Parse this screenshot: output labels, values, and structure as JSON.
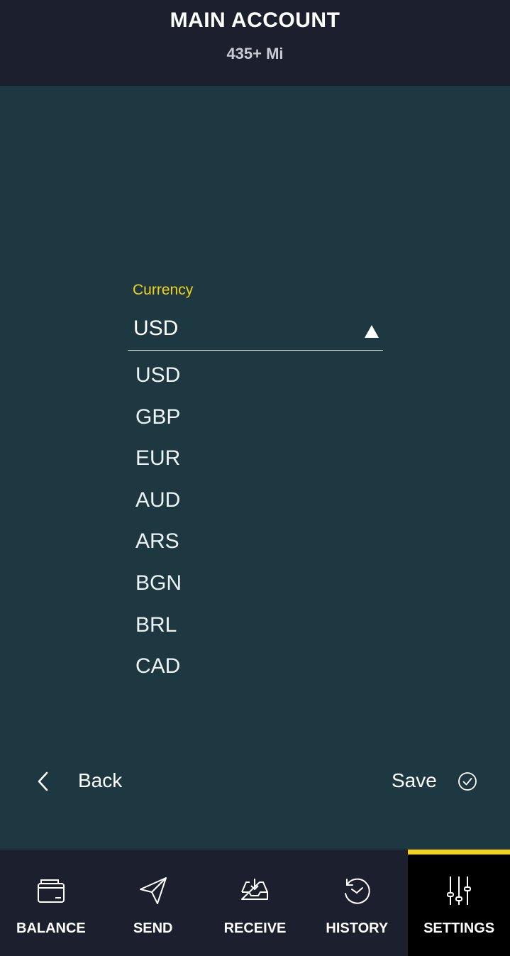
{
  "header": {
    "title": "MAIN ACCOUNT",
    "subtitle": "435+ Mi"
  },
  "form": {
    "currency_label": "Currency",
    "currency_value": "USD",
    "options": [
      "USD",
      "GBP",
      "EUR",
      "AUD",
      "ARS",
      "BGN",
      "BRL",
      "CAD"
    ]
  },
  "actions": {
    "back_label": "Back",
    "save_label": "Save"
  },
  "nav": {
    "items": [
      {
        "label": "BALANCE",
        "icon": "wallet-icon"
      },
      {
        "label": "SEND",
        "icon": "paper-plane-icon"
      },
      {
        "label": "RECEIVE",
        "icon": "inbox-download-icon"
      },
      {
        "label": "HISTORY",
        "icon": "history-clock-icon"
      },
      {
        "label": "SETTINGS",
        "icon": "sliders-icon"
      }
    ],
    "active": "SETTINGS"
  },
  "colors": {
    "accent": "#f2d21b",
    "background": "#1d3840",
    "bar": "#1c1f2e"
  }
}
